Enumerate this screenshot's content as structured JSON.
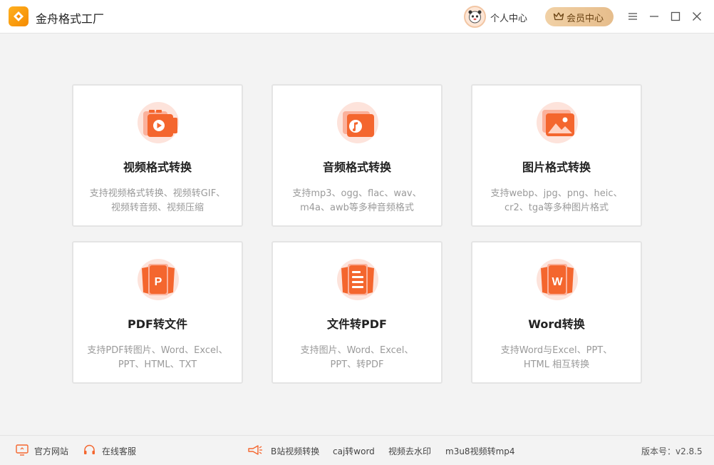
{
  "app": {
    "title": "金舟格式工厂",
    "accent": "#f4662e",
    "brand": "#f59a12"
  },
  "header": {
    "user_center": "个人中心",
    "vip_center": "会员中心",
    "icons": [
      "avatar",
      "crown-icon",
      "menu-icon",
      "minimize-icon",
      "maximize-icon",
      "close-icon"
    ]
  },
  "cards": [
    {
      "icon": "video-icon",
      "title": "视频格式转换",
      "desc1": "支持视频格式转换、视频转GIF、",
      "desc2": "视频转音频、视频压缩"
    },
    {
      "icon": "audio-icon",
      "title": "音频格式转换",
      "desc1": "支持mp3、ogg、flac、wav、",
      "desc2": "m4a、awb等多种音频格式"
    },
    {
      "icon": "image-icon",
      "title": "图片格式转换",
      "desc1": "支持webp、jpg、png、heic、",
      "desc2": "cr2、tga等多种图片格式"
    },
    {
      "icon": "pdf-icon",
      "title": "PDF转文件",
      "desc1": "支持PDF转图片、Word、Excel、",
      "desc2": "PPT、HTML、TXT"
    },
    {
      "icon": "document-icon",
      "title": "文件转PDF",
      "desc1": "支持图片、Word、Excel、",
      "desc2": "PPT、转PDF"
    },
    {
      "icon": "word-icon",
      "title": "Word转换",
      "desc1": "支持Word与Excel、PPT、",
      "desc2": "HTML 相互转换"
    }
  ],
  "footer": {
    "official_site": "官方网站",
    "online_service": "在线客服",
    "bilibili": "B站视频转换",
    "caj": "caj转word",
    "watermark": "视频去水印",
    "m3u8": "m3u8视频转mp4",
    "version": "版本号：v2.8.5"
  }
}
